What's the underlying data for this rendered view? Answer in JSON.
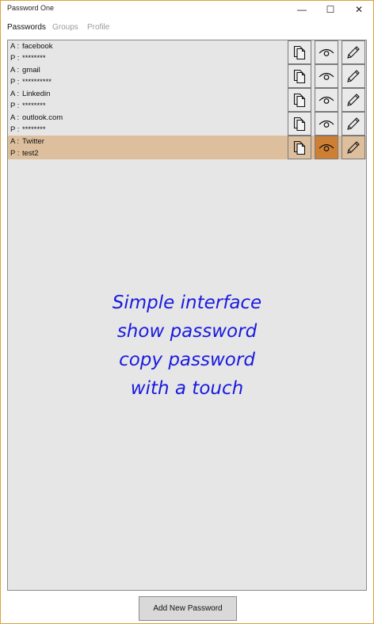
{
  "window": {
    "title": "Password One",
    "minimize": "—",
    "maximize": "☐",
    "close": "✕"
  },
  "tabs": [
    {
      "label": "Passwords",
      "active": true
    },
    {
      "label": "Groups",
      "active": false
    },
    {
      "label": "Profile",
      "active": false
    }
  ],
  "entries": [
    {
      "account_prefix": "A :",
      "account": "facebook",
      "password_prefix": "P :",
      "password": "********",
      "selected": false
    },
    {
      "account_prefix": "A :",
      "account": "gmail",
      "password_prefix": "P :",
      "password": "**********",
      "selected": false
    },
    {
      "account_prefix": "A :",
      "account": "Linkedin",
      "password_prefix": "P :",
      "password": "********",
      "selected": false
    },
    {
      "account_prefix": "A :",
      "account": "outlook.com",
      "password_prefix": "P :",
      "password": "********",
      "selected": false
    },
    {
      "account_prefix": "A :",
      "account": "Twitter",
      "password_prefix": "P :",
      "password": "test2",
      "selected": true
    }
  ],
  "row_icons": {
    "copy": "copy-icon",
    "show": "eye-icon",
    "edit": "pencil-icon"
  },
  "promo_lines": [
    "Simple interface",
    "show password",
    "copy password",
    "with a touch"
  ],
  "add_button_label": "Add New Password",
  "colors": {
    "selected_row": "#ddbf9d",
    "show_active": "#cf7f33",
    "promo_text": "#1a1adf"
  }
}
